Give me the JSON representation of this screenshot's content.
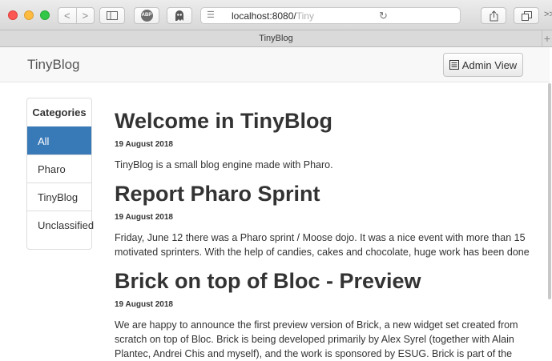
{
  "browser": {
    "address": "localhost:8080/",
    "address_faded": "Tiny",
    "tab_title": "TinyBlog",
    "tab_plus": "+",
    "more": ">>",
    "back": "<",
    "forward": ">",
    "adblock": "ABP"
  },
  "navbar": {
    "brand": "TinyBlog",
    "admin_label": "Admin View"
  },
  "sidebar": {
    "title": "Categories",
    "items": [
      {
        "label": "All",
        "active": true
      },
      {
        "label": "Pharo",
        "active": false
      },
      {
        "label": "TinyBlog",
        "active": false
      },
      {
        "label": "Unclassified",
        "active": false
      }
    ]
  },
  "posts": [
    {
      "title": "Welcome in TinyBlog",
      "date": "19 August 2018",
      "body": "TinyBlog is a small blog engine made with Pharo."
    },
    {
      "title": "Report Pharo Sprint",
      "date": "19 August 2018",
      "body": "Friday, June 12 there was a Pharo sprint / Moose dojo. It was a nice event with more than 15 motivated sprinters. With the help of candies, cakes and chocolate, huge work has been done"
    },
    {
      "title": "Brick on top of Bloc - Preview",
      "date": "19 August 2018",
      "body": "We are happy to announce the first preview version of Brick, a new widget set created from scratch on top of Bloc. Brick is being developed primarily by Alex Syrel (together with Alain Plantec, Andrei Chis and myself), and the work is sponsored by ESUG. Brick is part of the"
    }
  ]
}
